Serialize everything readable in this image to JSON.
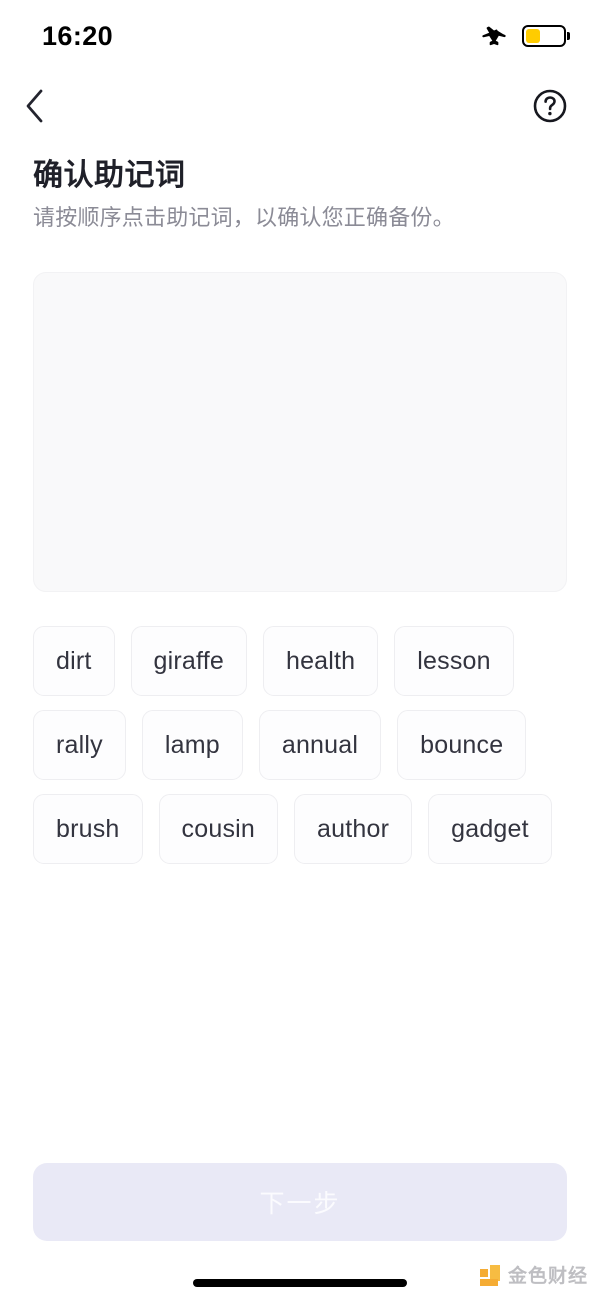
{
  "status_bar": {
    "time": "16:20",
    "airplane_icon": "airplane-mode-icon",
    "battery_icon": "battery-low-icon",
    "battery_level_percent": 40,
    "battery_color": "#FFCC00"
  },
  "nav": {
    "back_icon": "chevron-left-icon",
    "help_icon": "question-mark-circle-icon"
  },
  "header": {
    "title": "确认助记词",
    "subtitle": "请按顺序点击助记词，以确认您正确备份。"
  },
  "answer_area": {
    "selected_words": [],
    "background_color": "#f9f9fa"
  },
  "word_pool": {
    "words": [
      "dirt",
      "giraffe",
      "health",
      "lesson",
      "rally",
      "lamp",
      "annual",
      "bounce",
      "brush",
      "cousin",
      "author",
      "gadget"
    ]
  },
  "footer": {
    "next_label": "下一步",
    "next_disabled": true,
    "next_bg_color": "#e9e9f6",
    "next_text_color": "#fbfbfe"
  },
  "watermark": {
    "text": "金色财经",
    "logo_color": "#F5A623"
  }
}
